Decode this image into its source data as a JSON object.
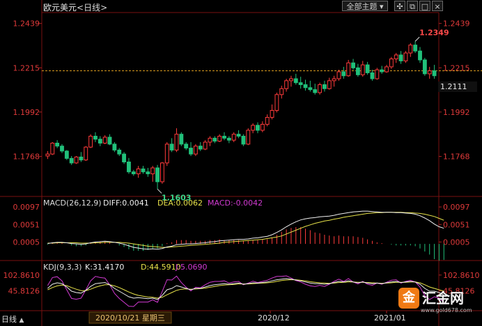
{
  "header": {
    "title": "欧元美元",
    "period": "<日线>",
    "theme_button": "全部主题",
    "icons": [
      "dropdown-icon",
      "crosshair-icon",
      "window-restore-icon",
      "window-maximize-icon",
      "close-icon"
    ]
  },
  "price_tag": "1.2111",
  "bottom_left_label": "日线",
  "logo": {
    "name": "汇金网",
    "mark": "金",
    "url": "www.gold678.com"
  },
  "colors": {
    "up": "#ff3b3b",
    "down": "#21c07a",
    "yellow": "#e8e34a",
    "white": "#f0f0f0",
    "magenta": "#d23ad2",
    "grid": "#7a1010"
  },
  "chart_data": [
    {
      "type": "candlestick",
      "ylim": [
        1.158,
        1.248
      ],
      "y_ticks": [
        "1.2439",
        "1.2215",
        "1.1992",
        "1.1768"
      ],
      "current_price": 1.2111,
      "reference_line": 1.22,
      "annotations": [
        {
          "text": "1.2349",
          "value": 1.2349
        },
        {
          "text": "1.1603",
          "value": 1.1603
        }
      ],
      "x_ticks": [
        "2020/10/21 星期三",
        "2020/12",
        "2021/01"
      ],
      "candles": [
        [
          1.177,
          1.1795,
          1.1755,
          1.178
        ],
        [
          1.178,
          1.184,
          1.1775,
          1.1835
        ],
        [
          1.1835,
          1.185,
          1.181,
          1.182
        ],
        [
          1.182,
          1.183,
          1.1785,
          1.1795
        ],
        [
          1.1795,
          1.18,
          1.175,
          1.1758
        ],
        [
          1.1758,
          1.177,
          1.1725,
          1.1735
        ],
        [
          1.1735,
          1.177,
          1.173,
          1.1765
        ],
        [
          1.1765,
          1.179,
          1.174,
          1.175
        ],
        [
          1.175,
          1.182,
          1.1745,
          1.1815
        ],
        [
          1.1815,
          1.188,
          1.181,
          1.187
        ],
        [
          1.187,
          1.189,
          1.184,
          1.1855
        ],
        [
          1.1855,
          1.187,
          1.182,
          1.1835
        ],
        [
          1.1835,
          1.1875,
          1.183,
          1.1865
        ],
        [
          1.1865,
          1.188,
          1.1825,
          1.183
        ],
        [
          1.183,
          1.184,
          1.179,
          1.18
        ],
        [
          1.18,
          1.181,
          1.177,
          1.178
        ],
        [
          1.178,
          1.179,
          1.173,
          1.174
        ],
        [
          1.174,
          1.176,
          1.168,
          1.169
        ],
        [
          1.169,
          1.17,
          1.167,
          1.168
        ],
        [
          1.168,
          1.172,
          1.166,
          1.1705
        ],
        [
          1.1705,
          1.172,
          1.168,
          1.169
        ],
        [
          1.169,
          1.171,
          1.1665,
          1.168
        ],
        [
          1.168,
          1.172,
          1.164,
          1.171
        ],
        [
          1.171,
          1.1725,
          1.1603,
          1.164
        ],
        [
          1.164,
          1.174,
          1.163,
          1.1735
        ],
        [
          1.1735,
          1.184,
          1.172,
          1.183
        ],
        [
          1.183,
          1.186,
          1.179,
          1.18
        ],
        [
          1.18,
          1.191,
          1.179,
          1.188
        ],
        [
          1.188,
          1.189,
          1.182,
          1.183
        ],
        [
          1.183,
          1.184,
          1.18,
          1.181
        ],
        [
          1.181,
          1.184,
          1.177,
          1.178
        ],
        [
          1.178,
          1.183,
          1.177,
          1.182
        ],
        [
          1.182,
          1.184,
          1.1795,
          1.1805
        ],
        [
          1.1805,
          1.185,
          1.18,
          1.184
        ],
        [
          1.184,
          1.187,
          1.182,
          1.186
        ],
        [
          1.186,
          1.187,
          1.1835,
          1.1845
        ],
        [
          1.1845,
          1.188,
          1.184,
          1.187
        ],
        [
          1.187,
          1.189,
          1.185,
          1.186
        ],
        [
          1.186,
          1.187,
          1.1835,
          1.185
        ],
        [
          1.185,
          1.189,
          1.184,
          1.188
        ],
        [
          1.188,
          1.19,
          1.186,
          1.187
        ],
        [
          1.187,
          1.188,
          1.182,
          1.183
        ],
        [
          1.183,
          1.191,
          1.1825,
          1.19
        ],
        [
          1.19,
          1.1935,
          1.1885,
          1.1925
        ],
        [
          1.1925,
          1.194,
          1.1885,
          1.19
        ],
        [
          1.19,
          1.1945,
          1.189,
          1.193
        ],
        [
          1.193,
          1.198,
          1.192,
          1.1965
        ],
        [
          1.1965,
          1.203,
          1.1955,
          1.2
        ],
        [
          1.2,
          1.209,
          1.199,
          1.208
        ],
        [
          1.208,
          1.2125,
          1.206,
          1.211
        ],
        [
          1.211,
          1.216,
          1.2095,
          1.215
        ],
        [
          1.215,
          1.2175,
          1.212,
          1.216
        ],
        [
          1.216,
          1.2185,
          1.213,
          1.214
        ],
        [
          1.214,
          1.217,
          1.211,
          1.213
        ],
        [
          1.213,
          1.2155,
          1.21,
          1.2115
        ],
        [
          1.2115,
          1.215,
          1.2095,
          1.2105
        ],
        [
          1.2105,
          1.2135,
          1.208,
          1.209
        ],
        [
          1.209,
          1.214,
          1.208,
          1.213
        ],
        [
          1.213,
          1.215,
          1.2095,
          1.211
        ],
        [
          1.211,
          1.2165,
          1.2105,
          1.215
        ],
        [
          1.215,
          1.2175,
          1.212,
          1.216
        ],
        [
          1.216,
          1.2205,
          1.215,
          1.2195
        ],
        [
          1.2195,
          1.222,
          1.216,
          1.2175
        ],
        [
          1.2175,
          1.2255,
          1.217,
          1.224
        ],
        [
          1.224,
          1.226,
          1.2205,
          1.2215
        ],
        [
          1.2215,
          1.2235,
          1.217,
          1.218
        ],
        [
          1.218,
          1.225,
          1.217,
          1.223
        ],
        [
          1.223,
          1.2245,
          1.218,
          1.219
        ],
        [
          1.219,
          1.2205,
          1.215,
          1.216
        ],
        [
          1.216,
          1.2215,
          1.2155,
          1.2205
        ],
        [
          1.2205,
          1.2225,
          1.2185,
          1.2195
        ],
        [
          1.2195,
          1.223,
          1.219,
          1.222
        ],
        [
          1.222,
          1.227,
          1.221,
          1.226
        ],
        [
          1.226,
          1.229,
          1.224,
          1.228
        ],
        [
          1.228,
          1.23,
          1.2235,
          1.225
        ],
        [
          1.225,
          1.23,
          1.224,
          1.229
        ],
        [
          1.229,
          1.234,
          1.227,
          1.233
        ],
        [
          1.233,
          1.2349,
          1.229,
          1.23
        ],
        [
          1.23,
          1.232,
          1.224,
          1.2255
        ],
        [
          1.2255,
          1.2265,
          1.2175,
          1.2185
        ],
        [
          1.2185,
          1.222,
          1.216,
          1.22
        ],
        [
          1.22,
          1.223,
          1.216,
          1.2175
        ]
      ]
    },
    {
      "type": "macd",
      "label": "MACD(26,12,9)",
      "diff_text": "DIFF:0.0041",
      "dea_text": "DEA:0.0062",
      "macd_text": "MACD:-0.0042",
      "y_ticks": [
        "0.0097",
        "0.0051",
        "0.0005"
      ],
      "ylim": [
        -0.004,
        0.011
      ],
      "diff": [
        0.0001,
        0.0003,
        0.0004,
        0.0004,
        0.0003,
        0.0001,
        0.0,
        -0.0001,
        0.0,
        0.0003,
        0.0005,
        0.0006,
        0.0007,
        0.0006,
        0.0004,
        0.0002,
        -0.0001,
        -0.0005,
        -0.0009,
        -0.0011,
        -0.0013,
        -0.0014,
        -0.0013,
        -0.0014,
        -0.0012,
        -0.0008,
        -0.0006,
        -0.0002,
        -0.0001,
        0.0,
        0.0,
        0.0001,
        0.0002,
        0.0003,
        0.0005,
        0.0006,
        0.0008,
        0.0009,
        0.001,
        0.0011,
        0.0012,
        0.0012,
        0.0013,
        0.0015,
        0.0016,
        0.0018,
        0.002,
        0.0024,
        0.003,
        0.0037,
        0.0045,
        0.0052,
        0.0058,
        0.0063,
        0.0066,
        0.0068,
        0.0069,
        0.0071,
        0.0072,
        0.0073,
        0.0075,
        0.0078,
        0.008,
        0.0082,
        0.0084,
        0.0085,
        0.0086,
        0.0086,
        0.0085,
        0.0084,
        0.0083,
        0.0083,
        0.0083,
        0.0082,
        0.0082,
        0.0081,
        0.008,
        0.0078,
        0.0074,
        0.0068,
        0.0061,
        0.0052,
        0.0045,
        0.0041
      ],
      "dea": [
        0.0002,
        0.0002,
        0.0003,
        0.0003,
        0.0003,
        0.0003,
        0.0003,
        0.0002,
        0.0002,
        0.0002,
        0.0003,
        0.0003,
        0.0004,
        0.0004,
        0.0004,
        0.0004,
        0.0003,
        0.0002,
        0.0,
        -0.0002,
        -0.0004,
        -0.0006,
        -0.0007,
        -0.0008,
        -0.0009,
        -0.0009,
        -0.0008,
        -0.0007,
        -0.0006,
        -0.0005,
        -0.0004,
        -0.0003,
        -0.0002,
        -0.0001,
        0.0,
        0.0001,
        0.0002,
        0.0004,
        0.0005,
        0.0006,
        0.0007,
        0.0008,
        0.0009,
        0.001,
        0.0011,
        0.0012,
        0.0014,
        0.0016,
        0.0018,
        0.0021,
        0.0026,
        0.0031,
        0.0036,
        0.0041,
        0.0046,
        0.005,
        0.0054,
        0.0057,
        0.006,
        0.0062,
        0.0065,
        0.0067,
        0.007,
        0.0072,
        0.0074,
        0.0076,
        0.0078,
        0.008,
        0.0081,
        0.0082,
        0.0082,
        0.0083,
        0.0083,
        0.0083,
        0.0083,
        0.0082,
        0.0082,
        0.0081,
        0.008,
        0.0078,
        0.0075,
        0.0072,
        0.0067,
        0.0062
      ],
      "hist": [
        -0.0002,
        0.0002,
        0.0002,
        0.0002,
        0.0,
        -0.0004,
        -0.0006,
        -0.0006,
        -0.0004,
        0.0002,
        0.0004,
        0.0006,
        0.0006,
        0.0004,
        0.0,
        -0.0004,
        -0.0008,
        -0.0014,
        -0.0018,
        -0.0018,
        -0.0018,
        -0.0016,
        -0.0012,
        -0.0012,
        -0.0006,
        0.0002,
        0.0004,
        0.001,
        0.001,
        0.001,
        0.0008,
        0.0008,
        0.0008,
        0.0008,
        0.001,
        0.001,
        0.0012,
        0.001,
        0.001,
        0.001,
        0.001,
        0.0008,
        0.0008,
        0.001,
        0.001,
        0.0012,
        0.0012,
        0.0016,
        0.0024,
        0.0032,
        0.0038,
        0.0042,
        0.0044,
        0.0044,
        0.004,
        0.0036,
        0.003,
        0.0028,
        0.0024,
        0.0022,
        0.002,
        0.0022,
        0.002,
        0.002,
        0.002,
        0.0018,
        0.0016,
        0.0012,
        0.0008,
        0.0004,
        0.0002,
        0.0,
        -0.0002,
        -0.0004,
        -0.0004,
        -0.0004,
        -0.0004,
        -0.0006,
        -0.0012,
        -0.002,
        -0.0028,
        -0.004,
        -0.0044,
        -0.0042
      ]
    },
    {
      "type": "kdj",
      "label": "KDJ(9,3,3)",
      "k_text": "K:31.4170",
      "d_text": "D:44.5910",
      "j_text": "J:5.0690",
      "y_ticks": [
        "102.8610",
        "45.8126"
      ],
      "ylim": [
        -20,
        130
      ],
      "k": [
        55,
        70,
        75,
        72,
        60,
        45,
        40,
        38,
        48,
        62,
        72,
        74,
        76,
        68,
        55,
        45,
        35,
        25,
        20,
        22,
        20,
        18,
        20,
        15,
        30,
        50,
        55,
        65,
        60,
        55,
        50,
        55,
        55,
        60,
        65,
        68,
        70,
        72,
        70,
        72,
        74,
        70,
        72,
        75,
        74,
        76,
        78,
        82,
        86,
        88,
        90,
        88,
        85,
        82,
        78,
        74,
        72,
        72,
        70,
        72,
        76,
        80,
        78,
        82,
        78,
        75,
        78,
        74,
        72,
        74,
        72,
        75,
        78,
        80,
        76,
        78,
        80,
        78,
        70,
        55,
        45,
        45,
        40,
        31
      ],
      "d": [
        50,
        58,
        64,
        67,
        65,
        58,
        52,
        47,
        47,
        52,
        59,
        64,
        68,
        68,
        64,
        58,
        50,
        42,
        35,
        30,
        27,
        24,
        23,
        20,
        23,
        32,
        40,
        48,
        52,
        53,
        52,
        53,
        54,
        56,
        59,
        62,
        65,
        67,
        68,
        69,
        71,
        71,
        71,
        72,
        73,
        74,
        75,
        77,
        80,
        83,
        85,
        86,
        86,
        84,
        82,
        79,
        77,
        75,
        74,
        73,
        74,
        76,
        77,
        78,
        78,
        77,
        77,
        76,
        75,
        74,
        73,
        74,
        75,
        77,
        77,
        77,
        78,
        78,
        75,
        68,
        60,
        55,
        50,
        45
      ],
      "j": [
        65,
        94,
        97,
        82,
        50,
        19,
        16,
        20,
        50,
        82,
        98,
        94,
        92,
        68,
        37,
        19,
        5,
        -9,
        -10,
        6,
        6,
        6,
        14,
        5,
        44,
        86,
        85,
        99,
        76,
        59,
        46,
        59,
        57,
        68,
        77,
        80,
        80,
        82,
        74,
        78,
        80,
        68,
        74,
        81,
        76,
        80,
        84,
        92,
        98,
        98,
        100,
        92,
        83,
        78,
        70,
        64,
        62,
        66,
        62,
        70,
        80,
        88,
        80,
        90,
        78,
        71,
        80,
        70,
        66,
        74,
        70,
        77,
        84,
        86,
        74,
        80,
        84,
        78,
        60,
        29,
        15,
        25,
        20,
        5
      ]
    }
  ]
}
